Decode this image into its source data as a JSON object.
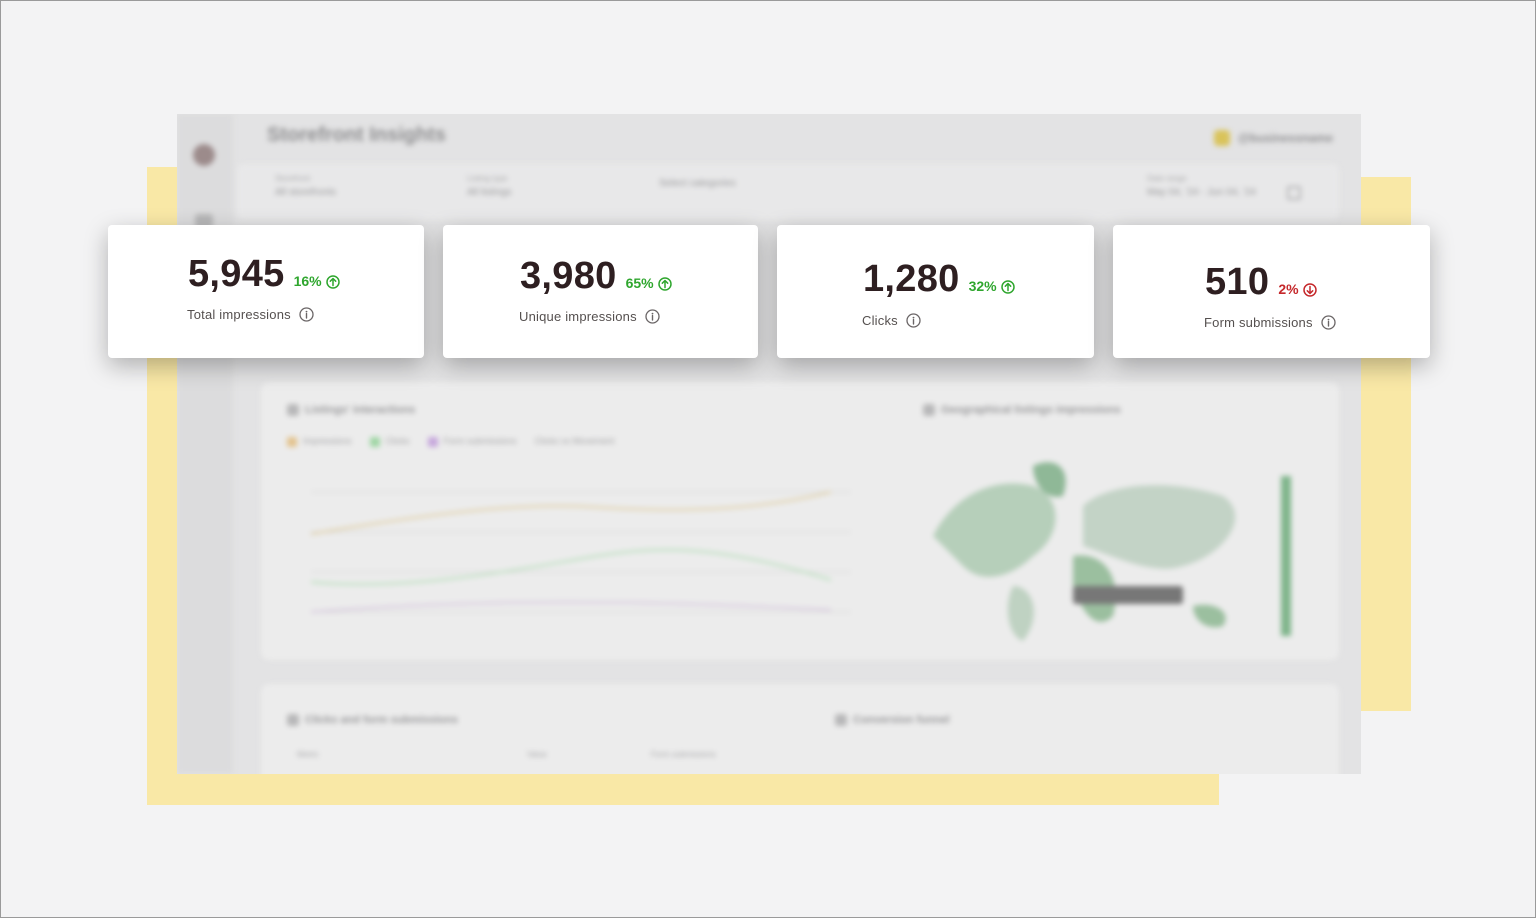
{
  "dashboard": {
    "title": "Storefront Insights",
    "user": "@businessname",
    "filters": [
      {
        "label": "Storefront",
        "value": "All storefronts"
      },
      {
        "label": "Listing type",
        "value": "All listings"
      },
      {
        "label": "",
        "value": "Select categories"
      }
    ],
    "date_range": {
      "label": "Date range",
      "value": "May 04, '24 - Jun 04, '24"
    },
    "panel_a": {
      "title": "Listings' interactions",
      "legend": [
        "Impressions",
        "Clicks",
        "Form submissions",
        "Clicks vs Movement"
      ],
      "map_title": "Geographical listings impressions"
    },
    "panel_b": {
      "title": "Clicks and form submissions",
      "funnel_title": "Conversion funnel",
      "columns": [
        "Metric",
        "Value",
        "Form submissions"
      ]
    }
  },
  "metrics": [
    {
      "value": "5,945",
      "change": "16%",
      "trend": "up",
      "label": "Total impressions"
    },
    {
      "value": "3,980",
      "change": "65%",
      "trend": "up",
      "label": "Unique impressions"
    },
    {
      "value": "1,280",
      "change": "32%",
      "trend": "up",
      "label": "Clicks"
    },
    {
      "value": "510",
      "change": "2%",
      "trend": "down",
      "label": "Form submissions"
    }
  ],
  "colors": {
    "up": "#2fa62e",
    "down": "#c5282b",
    "value_text": "#2e1f21",
    "highlight_yellow": "#f9e8a6"
  },
  "icons": {
    "trend_up": "arrow-up-circle-icon",
    "trend_down": "arrow-down-circle-icon",
    "info": "info-circle-icon"
  }
}
